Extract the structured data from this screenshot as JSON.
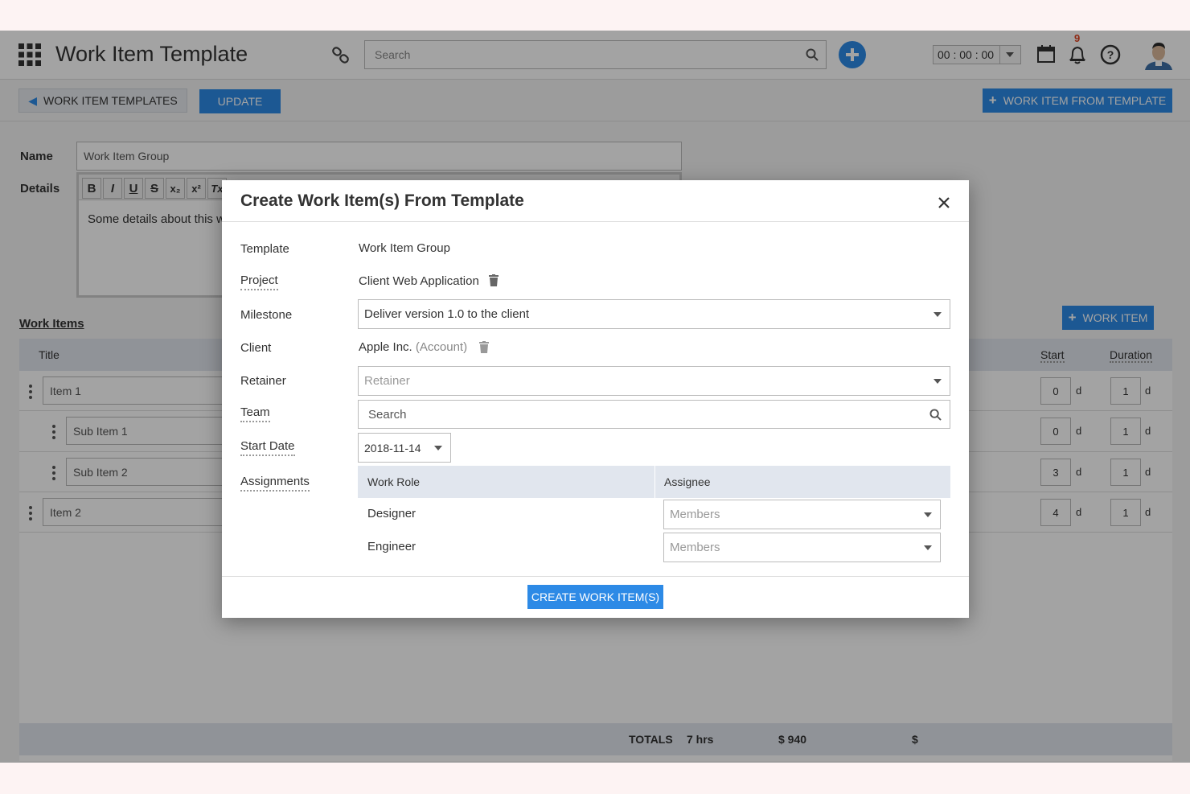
{
  "app": {
    "title": "Work Item Template",
    "search_placeholder": "Search",
    "timer": "00 : 00 : 00",
    "notification_count": "9"
  },
  "toolbar": {
    "back_label": "WORK ITEM TEMPLATES",
    "update_label": "UPDATE",
    "from_template_label": "WORK ITEM FROM TEMPLATE"
  },
  "form": {
    "name_label": "Name",
    "name_value": "Work Item Group",
    "details_label": "Details",
    "details_text": "Some details about this w",
    "formatting": [
      "B",
      "I",
      "U",
      "S",
      "x₂",
      "x²",
      "Tx"
    ]
  },
  "work_items": {
    "heading": "Work Items",
    "add_label": "WORK ITEM",
    "columns": {
      "title": "Title",
      "start": "Start",
      "duration": "Duration"
    },
    "unit": "d",
    "rows": [
      {
        "title": "Item 1",
        "start": "0",
        "duration": "1"
      },
      {
        "title": "Sub Item 1",
        "start": "0",
        "duration": "1"
      },
      {
        "title": "Sub Item 2",
        "start": "3",
        "duration": "1"
      },
      {
        "title": "Item 2",
        "start": "4",
        "duration": "1"
      }
    ],
    "totals": {
      "label": "TOTALS",
      "hours": "7 hrs",
      "cost": "$ 940",
      "currency": "$"
    }
  },
  "modal": {
    "title": "Create Work Item(s) From Template",
    "template_label": "Template",
    "template_value": "Work Item Group",
    "project_label": "Project",
    "project_value": "Client Web Application",
    "milestone_label": "Milestone",
    "milestone_value": "Deliver version 1.0 to the client",
    "client_label": "Client",
    "client_value": "Apple Inc.",
    "client_suffix": "(Account)",
    "retainer_label": "Retainer",
    "retainer_placeholder": "Retainer",
    "team_label": "Team",
    "team_placeholder": "Search",
    "start_date_label": "Start Date",
    "start_date_value": "2018-11-14",
    "assignments_label": "Assignments",
    "assign_columns": {
      "role": "Work Role",
      "assignee": "Assignee"
    },
    "assignments": [
      {
        "role": "Designer",
        "assignee_placeholder": "Members"
      },
      {
        "role": "Engineer",
        "assignee_placeholder": "Members"
      }
    ],
    "create_label": "CREATE WORK ITEM(S)"
  }
}
